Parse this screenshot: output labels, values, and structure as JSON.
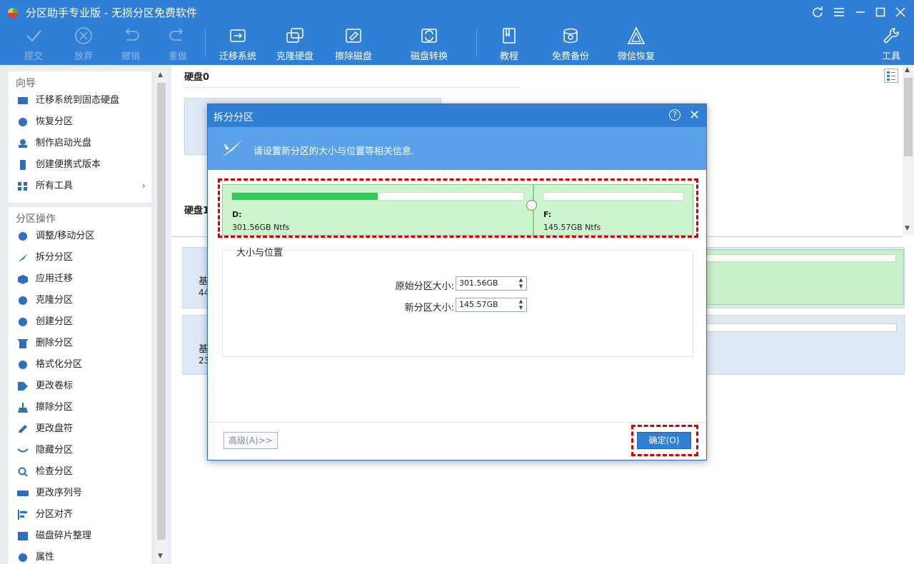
{
  "window": {
    "title": "分区助手专业版 - 无损分区免费软件"
  },
  "toolbar": {
    "commit": "提交",
    "discard": "放弃",
    "undo": "撤销",
    "redo": "重做",
    "migrate": "迁移系统",
    "clone_disk": "克隆硬盘",
    "wipe_disk": "擦除磁盘",
    "disk_convert": "磁盘转换",
    "tutorial": "教程",
    "backup": "免费备份",
    "wechat_recovery": "微信恢复",
    "tools": "工具"
  },
  "sidebar": {
    "wizard_title": "向导",
    "wizard_items": [
      "迁移系统到固态硬盘",
      "恢复分区",
      "制作启动光盘",
      "创建便携式版本",
      "所有工具"
    ],
    "ops_title": "分区操作",
    "ops_items": [
      "调整/移动分区",
      "拆分分区",
      "应用迁移",
      "克隆分区",
      "创建分区",
      "删除分区",
      "格式化分区",
      "更改卷标",
      "擦除分区",
      "更改盘符",
      "隐藏分区",
      "检查分区",
      "更改序列号",
      "分区对齐",
      "磁盘碎片整理",
      "属性"
    ]
  },
  "main": {
    "disk0": "硬盘0",
    "disk1": "硬盘1",
    "card1_line1": "基",
    "card1_line2": "44",
    "card2_line1": "基",
    "card2_line2": "23"
  },
  "dialog": {
    "title": "拆分分区",
    "help": "?",
    "banner": "请设置新分区的大小与位置等相关信息.",
    "partitions": [
      {
        "name": "D:",
        "size": "301.56GB Ntfs",
        "used_fraction": 0.5
      },
      {
        "name": "F:",
        "size": "145.57GB Ntfs",
        "used_fraction": 0
      }
    ],
    "group_title": "大小与位置",
    "orig_label": "原始分区大小:",
    "orig_value": "301.56GB",
    "new_label": "新分区大小:",
    "new_value": "145.57GB",
    "advanced": "高级(A)>>",
    "ok": "确定(O)"
  },
  "colors": {
    "accent": "#2f7fd6",
    "partition_bg": "#cdf5cd",
    "partition_fill": "#33c95a",
    "highlight": "#d40000"
  }
}
